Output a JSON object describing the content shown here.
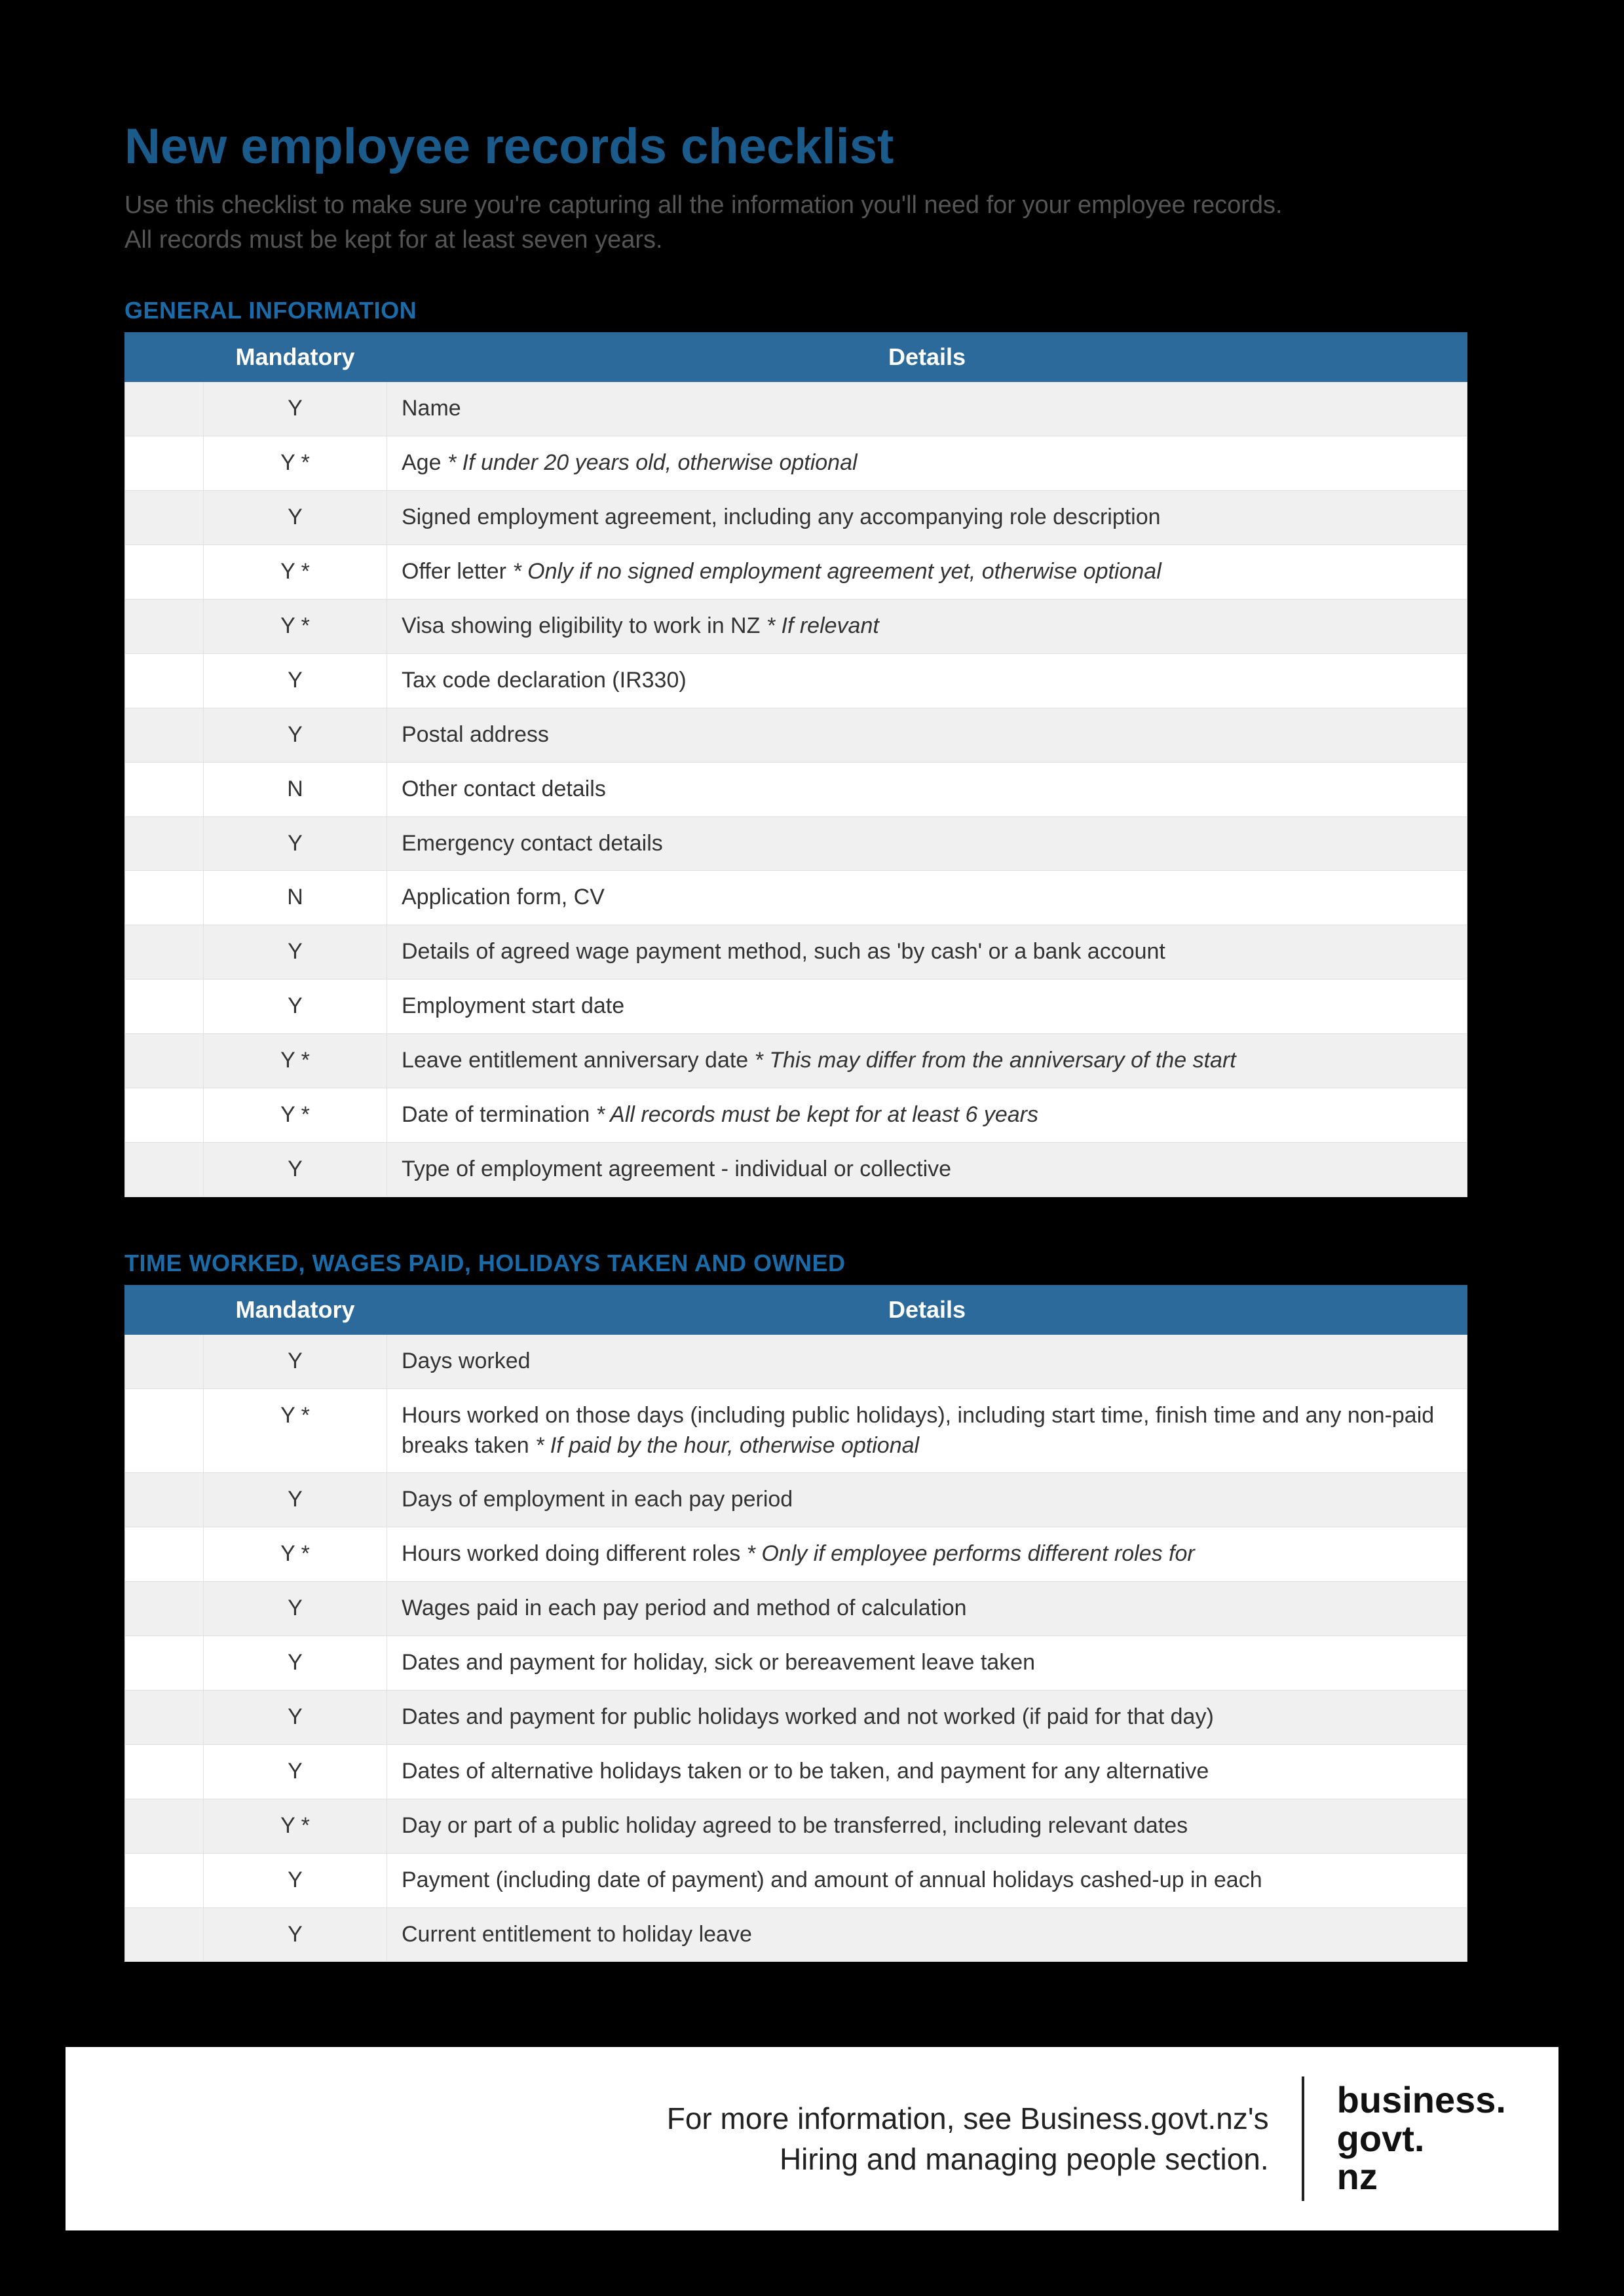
{
  "header": {
    "title": "New employee records checklist",
    "subtitle": "Use this checklist to make sure you're capturing all the information you'll need for your employee records. All records must be kept for at least seven years."
  },
  "sections": [
    {
      "heading": "GENERAL INFORMATION",
      "columns": {
        "check": "",
        "mandatory": "Mandatory",
        "details": "Details"
      },
      "rows": [
        {
          "mandatory": "Y",
          "details": "Name",
          "note": ""
        },
        {
          "mandatory": "Y *",
          "details": "Age",
          "note": "* If under 20 years old, otherwise optional"
        },
        {
          "mandatory": "Y",
          "details": "Signed employment agreement, including any accompanying role description",
          "note": ""
        },
        {
          "mandatory": "Y *",
          "details": "Offer letter",
          "note": "* Only if no signed employment agreement yet, otherwise optional"
        },
        {
          "mandatory": "Y *",
          "details": "Visa showing eligibility to work in NZ",
          "note": "* If relevant"
        },
        {
          "mandatory": "Y",
          "details": "Tax code declaration (IR330)",
          "note": ""
        },
        {
          "mandatory": "Y",
          "details": "Postal address",
          "note": ""
        },
        {
          "mandatory": "N",
          "details": "Other contact details",
          "note": ""
        },
        {
          "mandatory": "Y",
          "details": "Emergency contact details",
          "note": ""
        },
        {
          "mandatory": "N",
          "details": "Application form, CV",
          "note": ""
        },
        {
          "mandatory": "Y",
          "details": "Details of agreed wage payment method, such as 'by cash' or a bank account",
          "note": ""
        },
        {
          "mandatory": "Y",
          "details": "Employment start date",
          "note": ""
        },
        {
          "mandatory": "Y *",
          "details": "Leave entitlement anniversary date",
          "note": "* This may differ from the anniversary of the start"
        },
        {
          "mandatory": "Y *",
          "details": "Date of termination",
          "note": "* All records must be kept for at least 6 years"
        },
        {
          "mandatory": "Y",
          "details": "Type of employment agreement - individual or collective",
          "note": ""
        }
      ]
    },
    {
      "heading": "TIME WORKED, WAGES PAID, HOLIDAYS TAKEN AND OWNED",
      "columns": {
        "check": "",
        "mandatory": "Mandatory",
        "details": "Details"
      },
      "rows": [
        {
          "mandatory": "Y",
          "details": "Days worked",
          "note": ""
        },
        {
          "mandatory": "Y *",
          "details": "Hours worked on those days (including public holidays), including start time, finish time and any non-paid breaks taken",
          "note": "* If paid by the hour, otherwise optional"
        },
        {
          "mandatory": "Y",
          "details": "Days of employment in each pay period",
          "note": ""
        },
        {
          "mandatory": "Y *",
          "details": "Hours worked doing different roles",
          "note": "* Only if employee performs different roles for"
        },
        {
          "mandatory": "Y",
          "details": "Wages paid in each pay period and method of calculation",
          "note": ""
        },
        {
          "mandatory": "Y",
          "details": "Dates and payment for holiday, sick or bereavement leave taken",
          "note": ""
        },
        {
          "mandatory": "Y",
          "details": "Dates and payment for public holidays worked and not worked (if paid for that day)",
          "note": ""
        },
        {
          "mandatory": "Y",
          "details": "Dates of alternative holidays taken or to be taken, and payment for any alternative",
          "note": ""
        },
        {
          "mandatory": "Y *",
          "details": "Day or part of a public holiday agreed to be transferred, including relevant dates",
          "note": ""
        },
        {
          "mandatory": "Y",
          "details": "Payment (including date of payment) and amount of annual holidays cashed-up in each",
          "note": ""
        },
        {
          "mandatory": "Y",
          "details": "Current entitlement to holiday leave",
          "note": ""
        }
      ]
    }
  ],
  "footer": {
    "line1": "For more information, see Business.govt.nz's",
    "line2": "Hiring and managing people section.",
    "logo": "business.\ngovt.\nnz"
  }
}
